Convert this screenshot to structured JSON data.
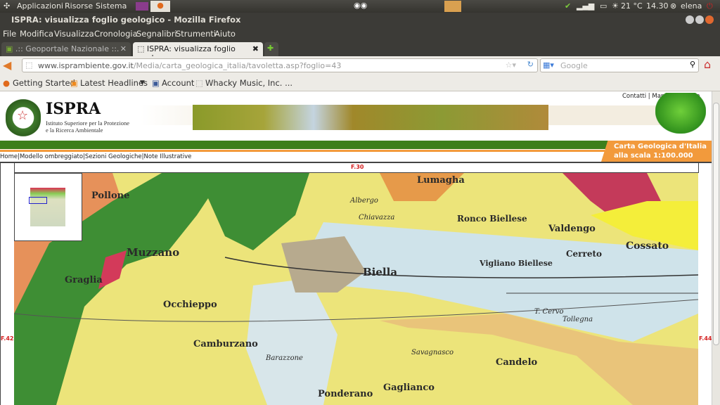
{
  "top_panel": {
    "menus": [
      "Applicazioni",
      "Risorse",
      "Sistema"
    ],
    "temperature": "21 °C",
    "time": "14.30",
    "user": "elena"
  },
  "window": {
    "title": "ISPRA: visualizza foglio geologico - Mozilla Firefox"
  },
  "menubar": [
    "File",
    "Modifica",
    "Visualizza",
    "Cronologia",
    "Segnalibri",
    "Strumenti",
    "Aiuto"
  ],
  "tabs": [
    {
      "label": ".:: Geoportale Nazionale ::.",
      "active": false
    },
    {
      "label": "ISPRA: visualizza foglio geol...",
      "active": true
    }
  ],
  "navbar": {
    "url_host": "www.isprambiente.gov.it",
    "url_path": "/Media/carta_geologica_italia/tavoletta.asp?foglio=43",
    "search_placeholder": "Google"
  },
  "bookmarks": [
    "Getting Started",
    "Latest Headlines",
    "Account",
    "Whacky Music, Inc. ..."
  ],
  "site": {
    "logo": "ISPRA",
    "subtitle1": "Istituto Superiore per la Protezione",
    "subtitle2": "e la Ricerca Ambientale",
    "top_links": "Contatti | Mappa | Ricerca",
    "badge1": "Carta Geologica d'Italia",
    "badge2": "alla scala 1:100.000",
    "nav": "Home|Modello ombreggiato|Sezioni Geologiche|Note Illustrative",
    "sheet_north": "F.30",
    "sheet_west": "F.42",
    "sheet_east": "F.44"
  },
  "map_labels": [
    "Pollone",
    "Muzzano",
    "Graglia",
    "Occhieppo",
    "Camburzano",
    "Barazzone",
    "Ponderano",
    "Biella",
    "Vigliano Biellese",
    "Ronco Biellese",
    "Valdengo",
    "Cerreto",
    "Cossato",
    "Candelo",
    "Gaglianco",
    "Lumagha",
    "Tollegna",
    "T. Cervo",
    "Savagnasco",
    "Chiavazza",
    "Albergo"
  ],
  "colors": {
    "green_bar": "#3d7f1c",
    "orange": "#f29a3c",
    "sheet_label": "#d42020"
  }
}
